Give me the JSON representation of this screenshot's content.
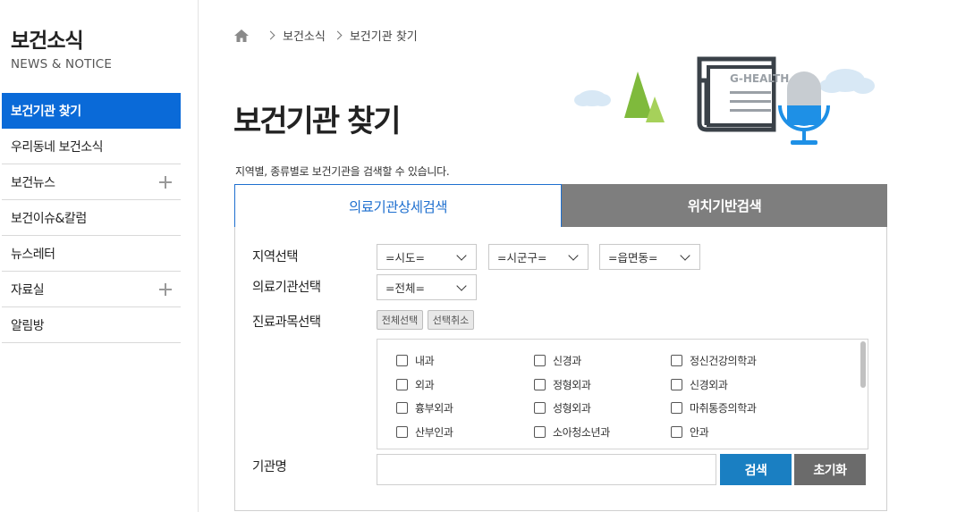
{
  "sidebar": {
    "title": "보건소식",
    "subtitle": "NEWS & NOTICE",
    "items": [
      {
        "label": "보건기관 찾기"
      },
      {
        "label": "우리동네 보건소식"
      },
      {
        "label": "보건뉴스"
      },
      {
        "label": "보건이슈&칼럼"
      },
      {
        "label": "뉴스레터"
      },
      {
        "label": "자료실"
      },
      {
        "label": "알림방"
      }
    ]
  },
  "breadcrumb": {
    "icon": "home-icon",
    "items": [
      "보건소식",
      "보건기관 찾기"
    ]
  },
  "page": {
    "title": "보건기관 찾기",
    "description": "지역별, 종류별로 보건기관을 검색할 수 있습니다.",
    "illustration_label": "G-HEALTH"
  },
  "tabs": [
    {
      "label": "의료기관상세검색"
    },
    {
      "label": "위치기반검색"
    }
  ],
  "form": {
    "region_label": "지역선택",
    "sido": "=시도=",
    "sigungu": "=시군구=",
    "eupmyeondong": "=읍면동=",
    "institution_label": "의료기관선택",
    "institution": "=전체=",
    "dept_label": "진료과목선택",
    "select_all": "전체선택",
    "deselect": "선택취소",
    "departments": [
      "내과",
      "신경과",
      "정신건강의학과",
      "외과",
      "정형외과",
      "신경외과",
      "흉부외과",
      "성형외과",
      "마취통증의학과",
      "산부인과",
      "소아청소년과",
      "안과"
    ],
    "name_label": "기관명",
    "name_value": "",
    "search_button": "검색",
    "reset_button": "초기화"
  },
  "colors": {
    "accent": "#0a6ad8",
    "tab_active": "#1e6fcf",
    "tab_inactive": "#7e7e7e",
    "search_button": "#1a7fc2",
    "reset_button": "#6b6b6b"
  }
}
